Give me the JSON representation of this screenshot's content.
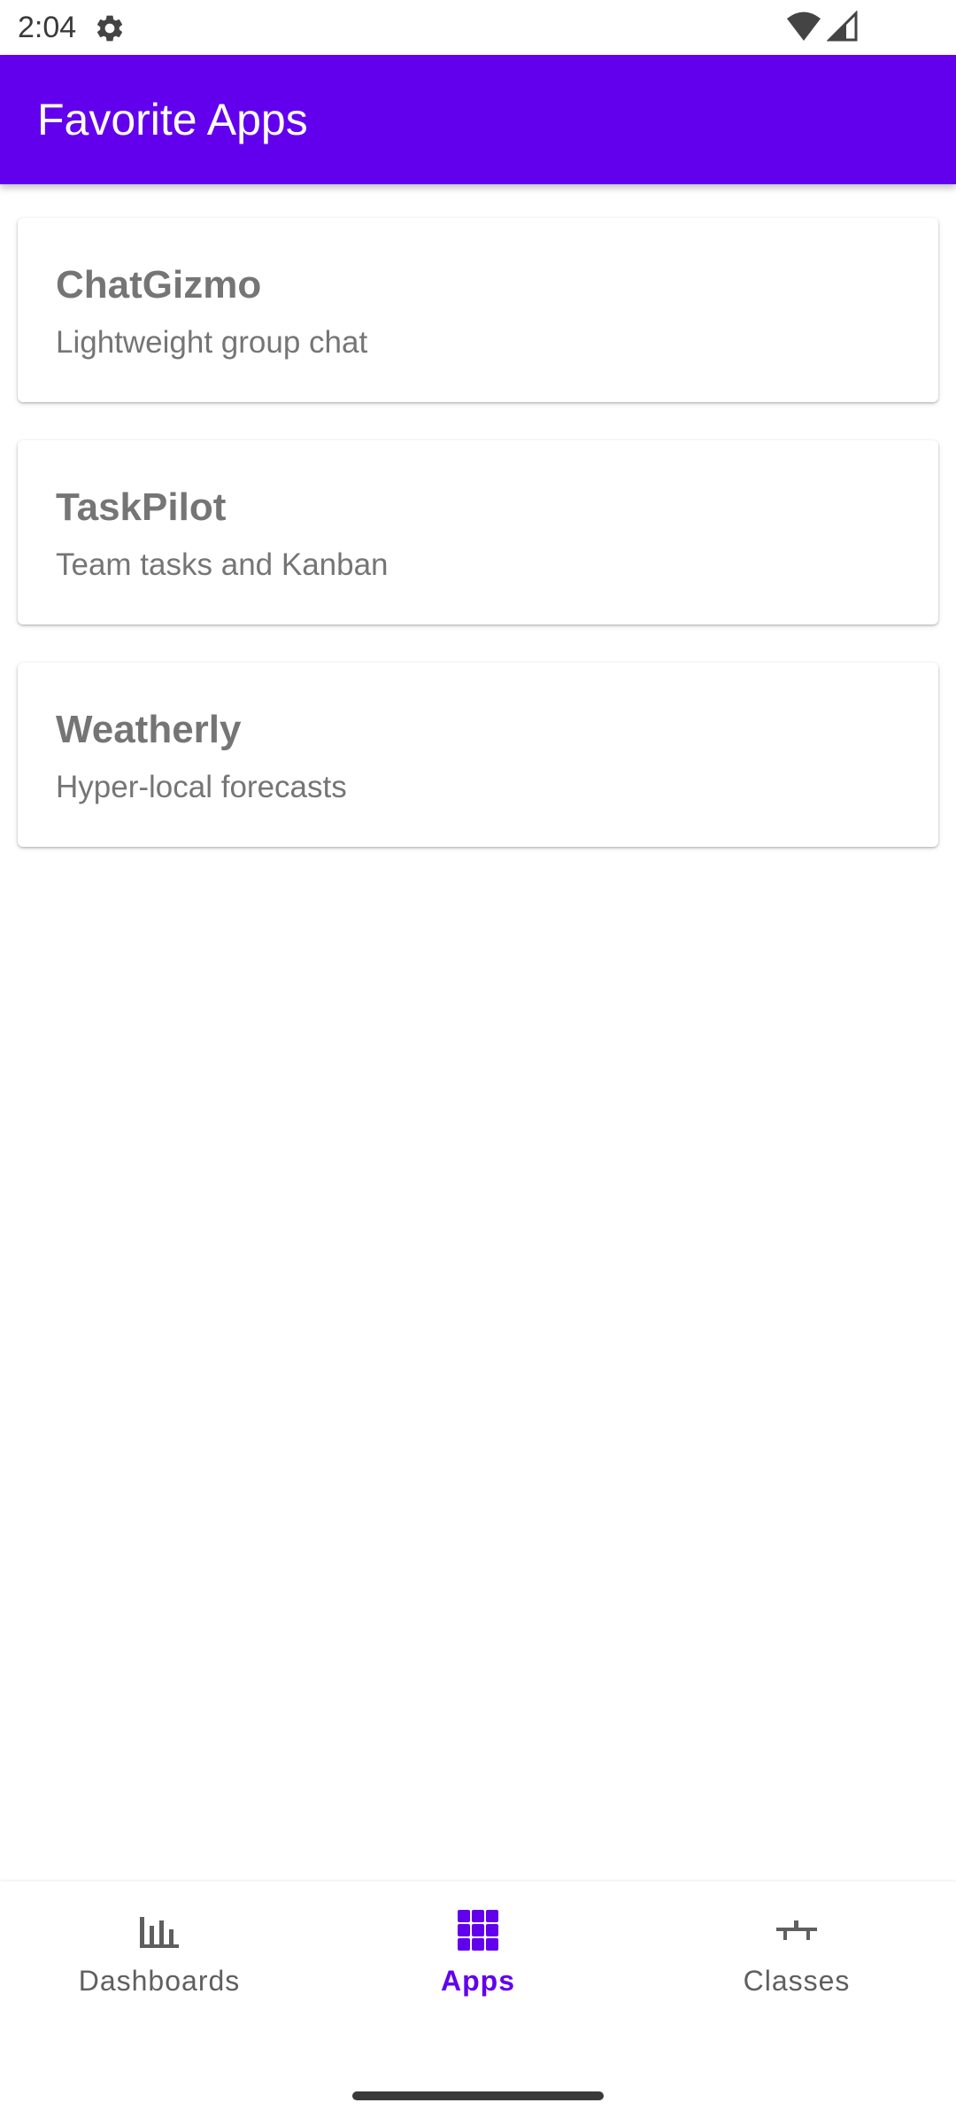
{
  "status_bar": {
    "time": "2:04",
    "icons": [
      "gear-icon",
      "wifi-icon",
      "signal-icon"
    ]
  },
  "app_bar": {
    "title": "Favorite Apps",
    "color": "#6200ee"
  },
  "apps": [
    {
      "name": "ChatGizmo",
      "description": "Lightweight group chat"
    },
    {
      "name": "TaskPilot",
      "description": "Team tasks and Kanban"
    },
    {
      "name": "Weatherly",
      "description": "Hyper-local forecasts"
    }
  ],
  "bottom_nav": {
    "items": [
      {
        "label": "Dashboards",
        "icon": "bar-chart-icon",
        "active": false
      },
      {
        "label": "Apps",
        "icon": "apps-grid-icon",
        "active": true
      },
      {
        "label": "Classes",
        "icon": "classes-icon",
        "active": false
      }
    ],
    "active_color": "#6200ee",
    "inactive_color": "#5f5f5f"
  }
}
